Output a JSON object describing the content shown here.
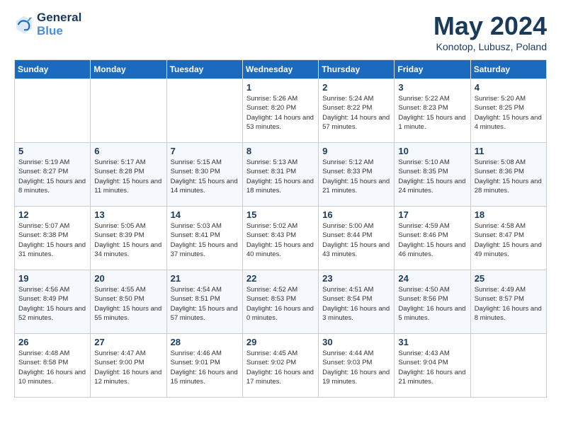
{
  "header": {
    "logo_line1": "General",
    "logo_line2": "Blue",
    "month": "May 2024",
    "location": "Konotop, Lubusz, Poland"
  },
  "days_of_week": [
    "Sunday",
    "Monday",
    "Tuesday",
    "Wednesday",
    "Thursday",
    "Friday",
    "Saturday"
  ],
  "weeks": [
    [
      {
        "day": "",
        "info": ""
      },
      {
        "day": "",
        "info": ""
      },
      {
        "day": "",
        "info": ""
      },
      {
        "day": "1",
        "info": "Sunrise: 5:26 AM\nSunset: 8:20 PM\nDaylight: 14 hours\nand 53 minutes."
      },
      {
        "day": "2",
        "info": "Sunrise: 5:24 AM\nSunset: 8:22 PM\nDaylight: 14 hours\nand 57 minutes."
      },
      {
        "day": "3",
        "info": "Sunrise: 5:22 AM\nSunset: 8:23 PM\nDaylight: 15 hours\nand 1 minute."
      },
      {
        "day": "4",
        "info": "Sunrise: 5:20 AM\nSunset: 8:25 PM\nDaylight: 15 hours\nand 4 minutes."
      }
    ],
    [
      {
        "day": "5",
        "info": "Sunrise: 5:19 AM\nSunset: 8:27 PM\nDaylight: 15 hours\nand 8 minutes."
      },
      {
        "day": "6",
        "info": "Sunrise: 5:17 AM\nSunset: 8:28 PM\nDaylight: 15 hours\nand 11 minutes."
      },
      {
        "day": "7",
        "info": "Sunrise: 5:15 AM\nSunset: 8:30 PM\nDaylight: 15 hours\nand 14 minutes."
      },
      {
        "day": "8",
        "info": "Sunrise: 5:13 AM\nSunset: 8:31 PM\nDaylight: 15 hours\nand 18 minutes."
      },
      {
        "day": "9",
        "info": "Sunrise: 5:12 AM\nSunset: 8:33 PM\nDaylight: 15 hours\nand 21 minutes."
      },
      {
        "day": "10",
        "info": "Sunrise: 5:10 AM\nSunset: 8:35 PM\nDaylight: 15 hours\nand 24 minutes."
      },
      {
        "day": "11",
        "info": "Sunrise: 5:08 AM\nSunset: 8:36 PM\nDaylight: 15 hours\nand 28 minutes."
      }
    ],
    [
      {
        "day": "12",
        "info": "Sunrise: 5:07 AM\nSunset: 8:38 PM\nDaylight: 15 hours\nand 31 minutes."
      },
      {
        "day": "13",
        "info": "Sunrise: 5:05 AM\nSunset: 8:39 PM\nDaylight: 15 hours\nand 34 minutes."
      },
      {
        "day": "14",
        "info": "Sunrise: 5:03 AM\nSunset: 8:41 PM\nDaylight: 15 hours\nand 37 minutes."
      },
      {
        "day": "15",
        "info": "Sunrise: 5:02 AM\nSunset: 8:43 PM\nDaylight: 15 hours\nand 40 minutes."
      },
      {
        "day": "16",
        "info": "Sunrise: 5:00 AM\nSunset: 8:44 PM\nDaylight: 15 hours\nand 43 minutes."
      },
      {
        "day": "17",
        "info": "Sunrise: 4:59 AM\nSunset: 8:46 PM\nDaylight: 15 hours\nand 46 minutes."
      },
      {
        "day": "18",
        "info": "Sunrise: 4:58 AM\nSunset: 8:47 PM\nDaylight: 15 hours\nand 49 minutes."
      }
    ],
    [
      {
        "day": "19",
        "info": "Sunrise: 4:56 AM\nSunset: 8:49 PM\nDaylight: 15 hours\nand 52 minutes."
      },
      {
        "day": "20",
        "info": "Sunrise: 4:55 AM\nSunset: 8:50 PM\nDaylight: 15 hours\nand 55 minutes."
      },
      {
        "day": "21",
        "info": "Sunrise: 4:54 AM\nSunset: 8:51 PM\nDaylight: 15 hours\nand 57 minutes."
      },
      {
        "day": "22",
        "info": "Sunrise: 4:52 AM\nSunset: 8:53 PM\nDaylight: 16 hours\nand 0 minutes."
      },
      {
        "day": "23",
        "info": "Sunrise: 4:51 AM\nSunset: 8:54 PM\nDaylight: 16 hours\nand 3 minutes."
      },
      {
        "day": "24",
        "info": "Sunrise: 4:50 AM\nSunset: 8:56 PM\nDaylight: 16 hours\nand 5 minutes."
      },
      {
        "day": "25",
        "info": "Sunrise: 4:49 AM\nSunset: 8:57 PM\nDaylight: 16 hours\nand 8 minutes."
      }
    ],
    [
      {
        "day": "26",
        "info": "Sunrise: 4:48 AM\nSunset: 8:58 PM\nDaylight: 16 hours\nand 10 minutes."
      },
      {
        "day": "27",
        "info": "Sunrise: 4:47 AM\nSunset: 9:00 PM\nDaylight: 16 hours\nand 12 minutes."
      },
      {
        "day": "28",
        "info": "Sunrise: 4:46 AM\nSunset: 9:01 PM\nDaylight: 16 hours\nand 15 minutes."
      },
      {
        "day": "29",
        "info": "Sunrise: 4:45 AM\nSunset: 9:02 PM\nDaylight: 16 hours\nand 17 minutes."
      },
      {
        "day": "30",
        "info": "Sunrise: 4:44 AM\nSunset: 9:03 PM\nDaylight: 16 hours\nand 19 minutes."
      },
      {
        "day": "31",
        "info": "Sunrise: 4:43 AM\nSunset: 9:04 PM\nDaylight: 16 hours\nand 21 minutes."
      },
      {
        "day": "",
        "info": ""
      }
    ]
  ]
}
